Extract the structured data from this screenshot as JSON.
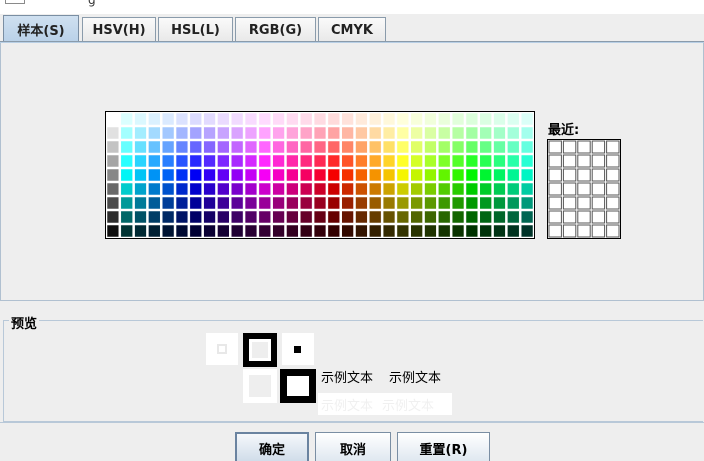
{
  "window": {
    "title_fragment": "g"
  },
  "tabs": [
    {
      "label": "样本(S)",
      "selected": true
    },
    {
      "label": "HSV(H)",
      "selected": false
    },
    {
      "label": "HSL(L)",
      "selected": false
    },
    {
      "label": "RGB(G)",
      "selected": false
    },
    {
      "label": "CMYK",
      "selected": false
    }
  ],
  "swatches": {
    "recent_label": "最近:",
    "grid_columns": 31,
    "grid_rows": 9,
    "recent_columns": 5,
    "recent_rows": 7
  },
  "preview": {
    "section_label": "预览",
    "sample_text": "示例文本",
    "colors": {
      "foreground": "#000000",
      "background": "#ffffff"
    }
  },
  "buttons": {
    "ok": "确定",
    "cancel": "取消",
    "reset": "重置(R)"
  },
  "colors": {
    "tab_selected": "#b8d0e8",
    "panel_bg": "#eeeeee",
    "border": "#8a9bab"
  }
}
